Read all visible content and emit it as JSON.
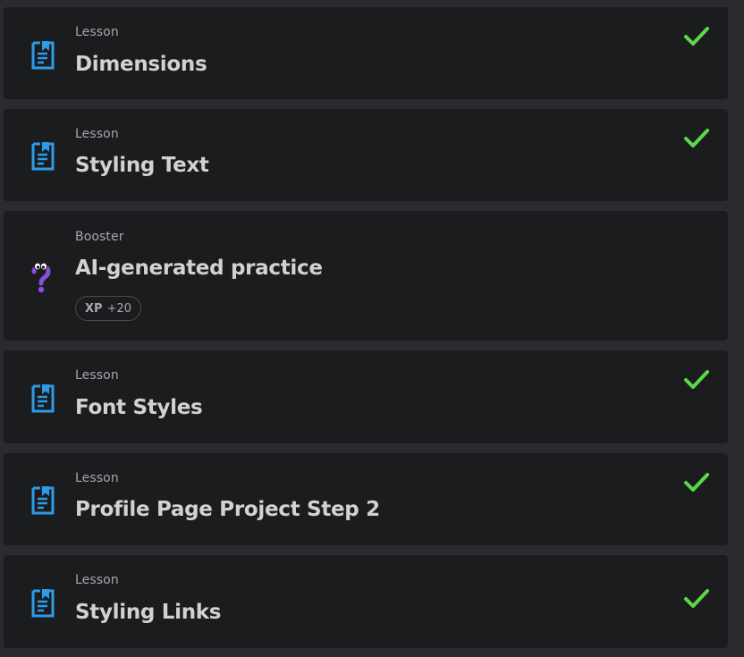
{
  "colors": {
    "page_background": "#2a2b2e",
    "card_background": "#1b1c1e",
    "lesson_icon": "#2c9be8",
    "booster_icon": "#8a4ed8",
    "check": "#5cd94a",
    "title_text": "#d4d2d0",
    "kind_text": "#a6a7ab"
  },
  "items": [
    {
      "kind": "Lesson",
      "title": "Dimensions",
      "icon": "document-bookmark-icon",
      "completed": true
    },
    {
      "kind": "Lesson",
      "title": "Styling Text",
      "icon": "document-bookmark-icon",
      "completed": true
    },
    {
      "kind": "Booster",
      "title": "AI-generated practice",
      "icon": "question-mark-character-icon",
      "completed": false,
      "xp": {
        "label": "XP",
        "value": "+20"
      }
    },
    {
      "kind": "Lesson",
      "title": "Font Styles",
      "icon": "document-bookmark-icon",
      "completed": true
    },
    {
      "kind": "Lesson",
      "title": "Profile Page Project Step 2",
      "icon": "document-bookmark-icon",
      "completed": true
    },
    {
      "kind": "Lesson",
      "title": "Styling Links",
      "icon": "document-bookmark-icon",
      "completed": true
    }
  ]
}
